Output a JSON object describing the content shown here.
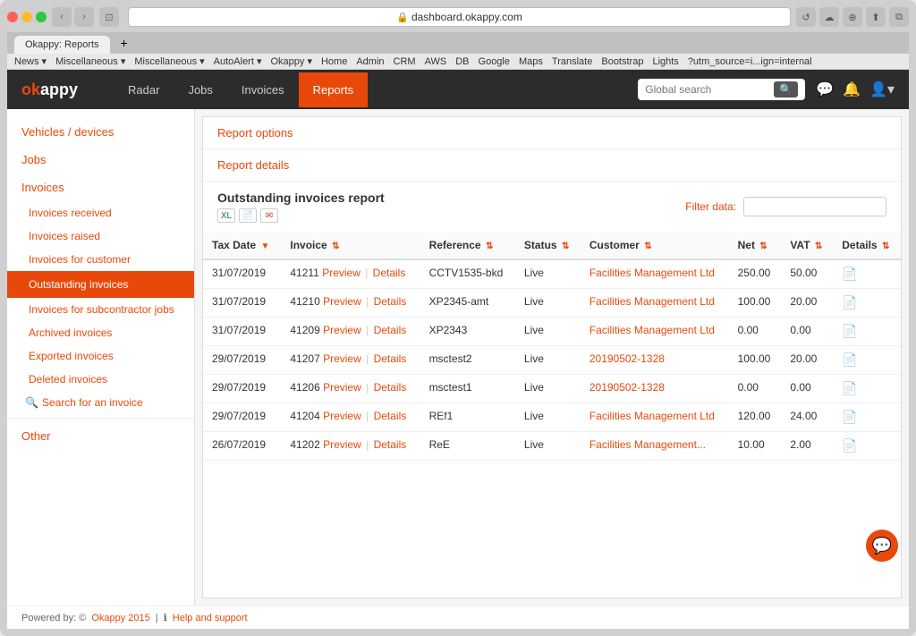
{
  "browser": {
    "address": "dashboard.okappy.com",
    "tab_title": "Okappy: Reports",
    "bookmarks": [
      "News",
      "Miscellaneous",
      "Miscellaneous",
      "AutoAlert",
      "Okappy",
      "Home",
      "Admin",
      "CRM",
      "AWS",
      "DB",
      "Google",
      "Maps",
      "Translate",
      "Bootstrap",
      "Lights",
      "?utm_source=i...ign=internal"
    ]
  },
  "app": {
    "logo": "okappy",
    "nav_links": [
      {
        "label": "Radar",
        "active": false
      },
      {
        "label": "Jobs",
        "active": false
      },
      {
        "label": "Invoices",
        "active": false
      },
      {
        "label": "Reports",
        "active": true
      }
    ],
    "search_placeholder": "Global search",
    "search_button": "🔍"
  },
  "sidebar": {
    "sections": [
      {
        "title": "Vehicles / devices",
        "items": []
      },
      {
        "title": "Jobs",
        "items": []
      },
      {
        "title": "Invoices",
        "items": [
          {
            "label": "Invoices received",
            "active": false
          },
          {
            "label": "Invoices raised",
            "active": false
          },
          {
            "label": "Invoices for customer",
            "active": false
          },
          {
            "label": "Outstanding invoices",
            "active": true
          },
          {
            "label": "Invoices for subcontractor jobs",
            "active": false
          },
          {
            "label": "Archived invoices",
            "active": false
          },
          {
            "label": "Exported invoices",
            "active": false
          },
          {
            "label": "Deleted invoices",
            "active": false
          }
        ]
      }
    ],
    "search_label": "Search for an invoice",
    "other_label": "Other"
  },
  "report": {
    "options_label": "Report options",
    "details_label": "Report details",
    "title": "Outstanding invoices report",
    "filter_label": "Filter data:",
    "filter_placeholder": "",
    "icons": [
      {
        "label": "XL",
        "type": "xl"
      },
      {
        "label": "CSV",
        "type": "csv"
      },
      {
        "label": "✉",
        "type": "email"
      }
    ]
  },
  "table": {
    "columns": [
      {
        "label": "Tax Date",
        "sortable": true
      },
      {
        "label": "Invoice",
        "sortable": true
      },
      {
        "label": "Reference",
        "sortable": true
      },
      {
        "label": "Status",
        "sortable": true
      },
      {
        "label": "Customer",
        "sortable": true
      },
      {
        "label": "Net",
        "sortable": true
      },
      {
        "label": "VAT",
        "sortable": true
      },
      {
        "label": "Details",
        "sortable": true
      }
    ],
    "rows": [
      {
        "tax_date": "31/07/2019",
        "invoice_num": "41211",
        "reference": "CCTV1535-bkd",
        "status": "Live",
        "customer": "Facilities Management Ltd",
        "net": "250.00",
        "vat": "50.00",
        "has_doc": true
      },
      {
        "tax_date": "31/07/2019",
        "invoice_num": "41210",
        "reference": "XP2345-amt",
        "status": "Live",
        "customer": "Facilities Management Ltd",
        "net": "100.00",
        "vat": "20.00",
        "has_doc": true
      },
      {
        "tax_date": "31/07/2019",
        "invoice_num": "41209",
        "reference": "XP2343",
        "status": "Live",
        "customer": "Facilities Management Ltd",
        "net": "0.00",
        "vat": "0.00",
        "has_doc": true
      },
      {
        "tax_date": "29/07/2019",
        "invoice_num": "41207",
        "reference": "msctest2",
        "status": "Live",
        "customer": "20190502-1328",
        "net": "100.00",
        "vat": "20.00",
        "has_doc": true
      },
      {
        "tax_date": "29/07/2019",
        "invoice_num": "41206",
        "reference": "msctest1",
        "status": "Live",
        "customer": "20190502-1328",
        "net": "0.00",
        "vat": "0.00",
        "has_doc": true
      },
      {
        "tax_date": "29/07/2019",
        "invoice_num": "41204",
        "reference": "REf1",
        "status": "Live",
        "customer": "Facilities Management Ltd",
        "net": "120.00",
        "vat": "24.00",
        "has_doc": true
      },
      {
        "tax_date": "26/07/2019",
        "invoice_num": "41202",
        "reference": "ReE",
        "status": "Live",
        "customer": "Facilities Management...",
        "net": "10.00",
        "vat": "2.00",
        "has_doc": true
      }
    ]
  },
  "footer": {
    "powered_by": "Powered by: © ",
    "brand": "Okappy 2015",
    "separator": " | ",
    "help_icon": "ℹ",
    "help_label": "Help and support"
  }
}
